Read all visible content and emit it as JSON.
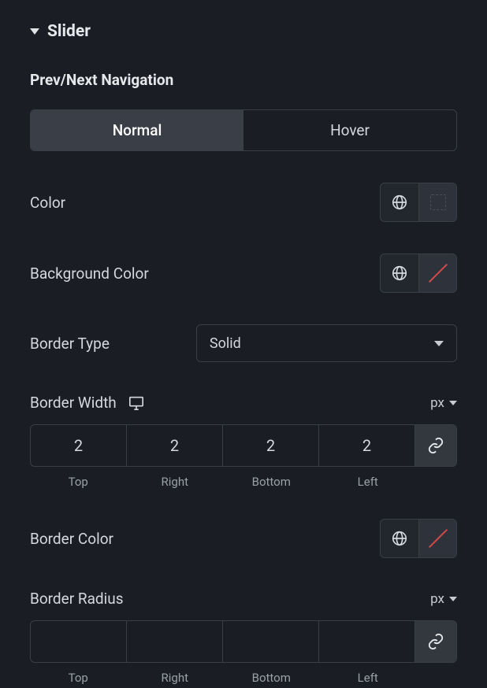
{
  "section": {
    "title": "Slider"
  },
  "subsection": {
    "title": "Prev/Next Navigation"
  },
  "tabs": {
    "normal": "Normal",
    "hover": "Hover",
    "active": "normal"
  },
  "color": {
    "label": "Color"
  },
  "backgroundColor": {
    "label": "Background Color"
  },
  "borderType": {
    "label": "Border Type",
    "value": "Solid"
  },
  "borderWidth": {
    "label": "Border Width",
    "unit": "px",
    "top": "2",
    "right": "2",
    "bottom": "2",
    "left": "2",
    "labels": {
      "top": "Top",
      "right": "Right",
      "bottom": "Bottom",
      "left": "Left"
    }
  },
  "borderColor": {
    "label": "Border Color"
  },
  "borderRadius": {
    "label": "Border Radius",
    "unit": "px",
    "top": "",
    "right": "",
    "bottom": "",
    "left": "",
    "labels": {
      "top": "Top",
      "right": "Right",
      "bottom": "Bottom",
      "left": "Left"
    }
  }
}
